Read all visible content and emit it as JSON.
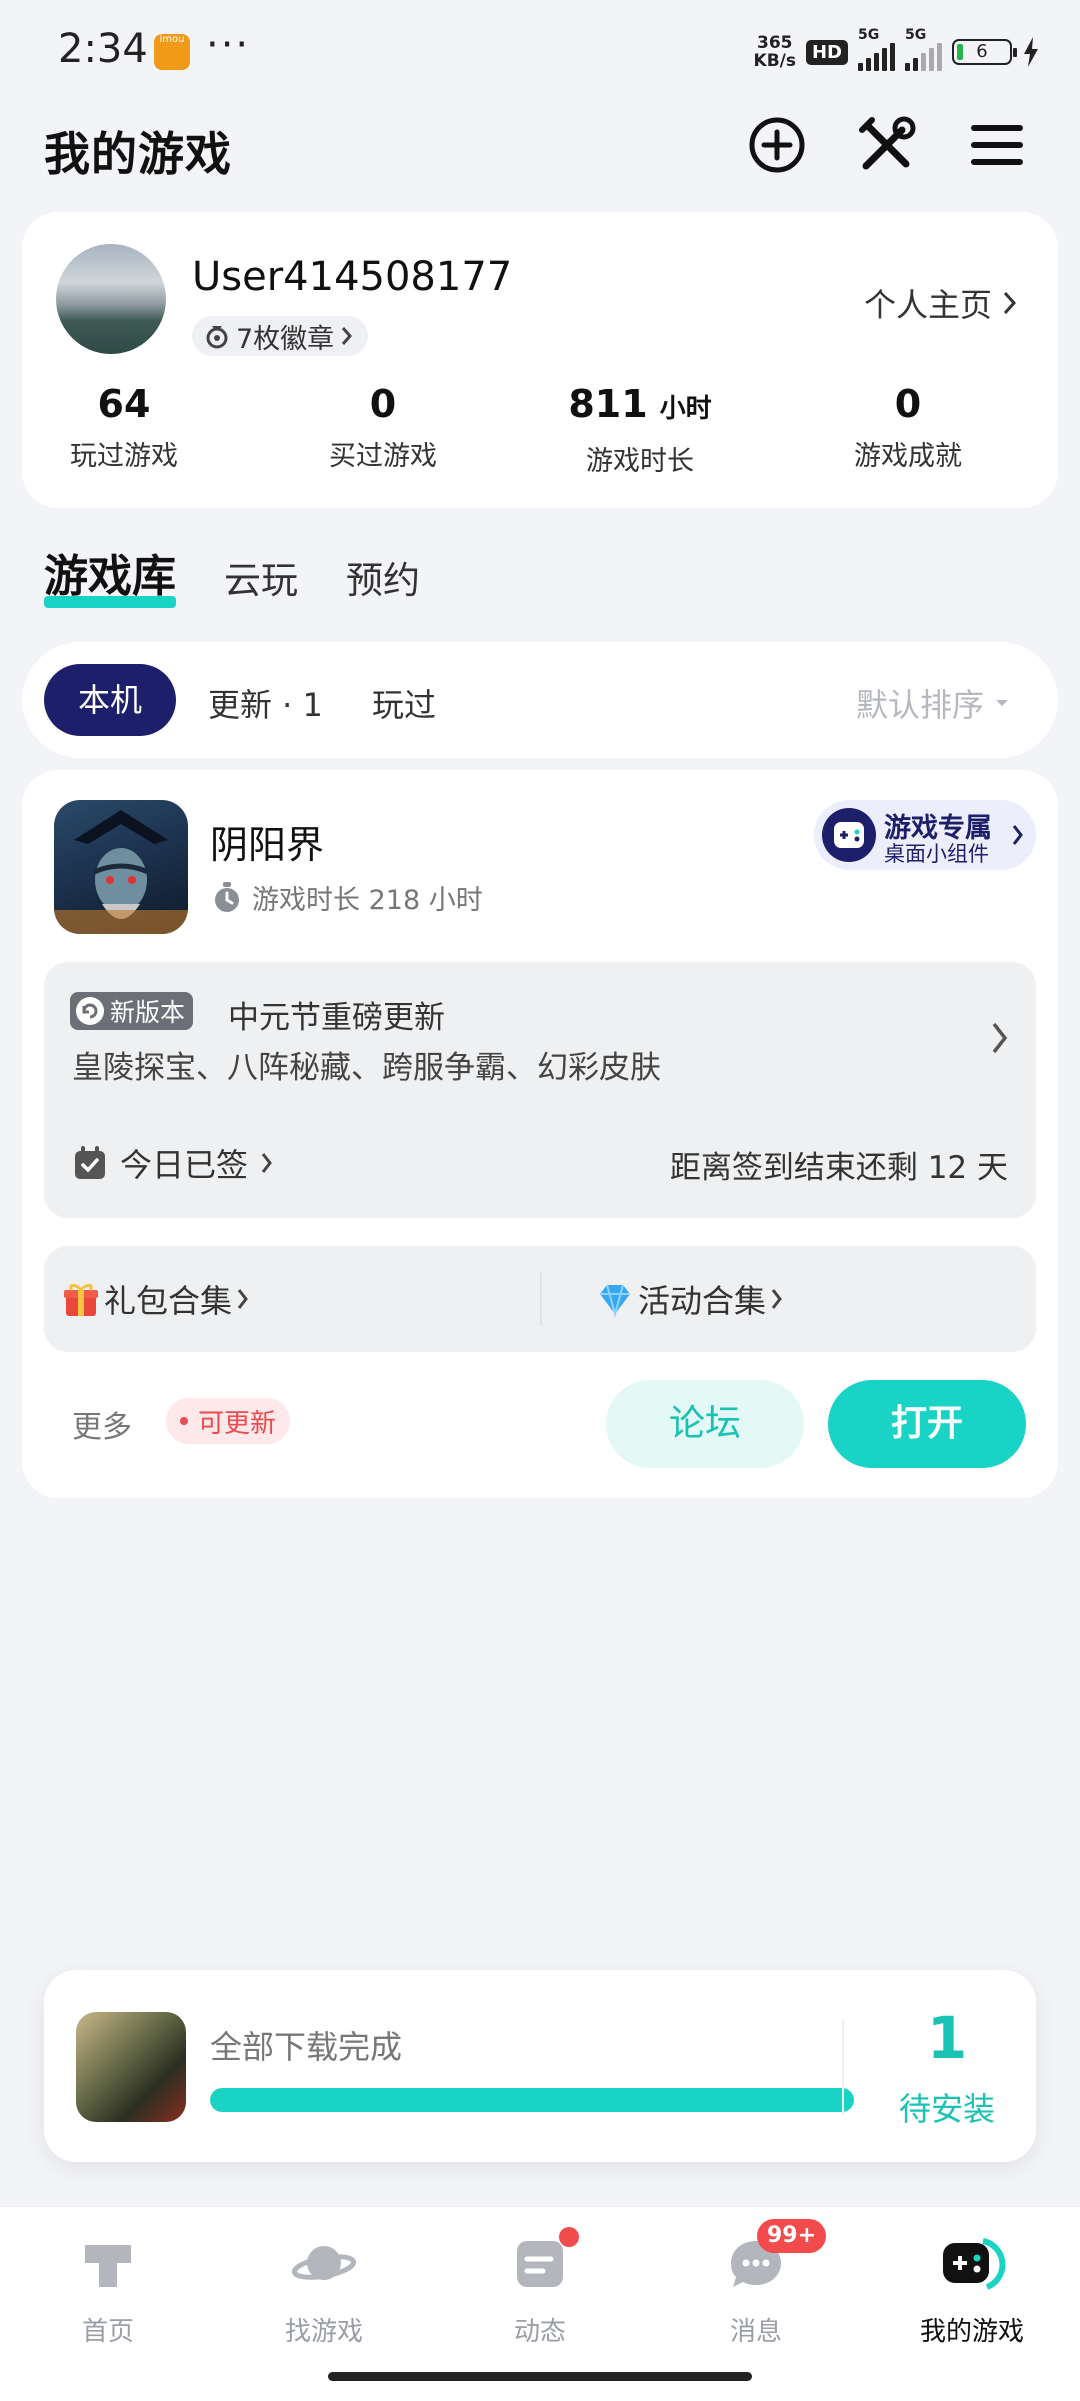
{
  "status_bar": {
    "time": "2:34",
    "app_icon_text": "imou",
    "dots": "···",
    "net_speed_top": "365",
    "net_speed_bottom": "KB/s",
    "hd": "HD",
    "signal1_label": "5G",
    "signal2_label": "5G",
    "battery": "6"
  },
  "header": {
    "title": "我的游戏",
    "icons": [
      "add-circle-icon",
      "tools-icon",
      "menu-icon"
    ]
  },
  "profile": {
    "username": "User414508177",
    "badges": "7枚徽章",
    "profile_link": "个人主页",
    "stats": [
      {
        "value": "64",
        "unit": "",
        "label": "玩过游戏"
      },
      {
        "value": "0",
        "unit": "",
        "label": "买过游戏"
      },
      {
        "value": "811",
        "unit": "小时",
        "label": "游戏时长"
      },
      {
        "value": "0",
        "unit": "",
        "label": "游戏成就"
      }
    ]
  },
  "library_tabs": [
    "游戏库",
    "云玩",
    "预约"
  ],
  "filters": {
    "local": "本机",
    "update": "更新 · 1",
    "played": "玩过",
    "sort": "默认排序"
  },
  "game": {
    "name": "阴阳界",
    "playtime": "游戏时长 218 小时",
    "widget_title": "游戏专属",
    "widget_sub": "桌面小组件",
    "version_tag": "新版本",
    "update_title": "中元节重磅更新",
    "update_desc": "皇陵探宝、八阵秘藏、跨服争霸、幻彩皮肤",
    "signin": "今日已签",
    "signin_remain": "距离签到结束还剩 12 天",
    "gift_collection": "礼包合集",
    "activity_collection": "活动合集",
    "more": "更多",
    "updatable": "可更新",
    "forum": "论坛",
    "open": "打开"
  },
  "download": {
    "status": "全部下载完成",
    "progress": 1.0,
    "count": "1",
    "pending_label": "待安装"
  },
  "bottom_nav": [
    {
      "label": "首页",
      "icon": "home-icon"
    },
    {
      "label": "找游戏",
      "icon": "planet-icon"
    },
    {
      "label": "动态",
      "icon": "feed-icon"
    },
    {
      "label": "消息",
      "icon": "message-icon",
      "badge": "99+"
    },
    {
      "label": "我的游戏",
      "icon": "gamepad-icon"
    }
  ],
  "colors": {
    "accent": "#19d3c5",
    "navy": "#1e1f6b",
    "badge_red": "#f14b4b"
  }
}
